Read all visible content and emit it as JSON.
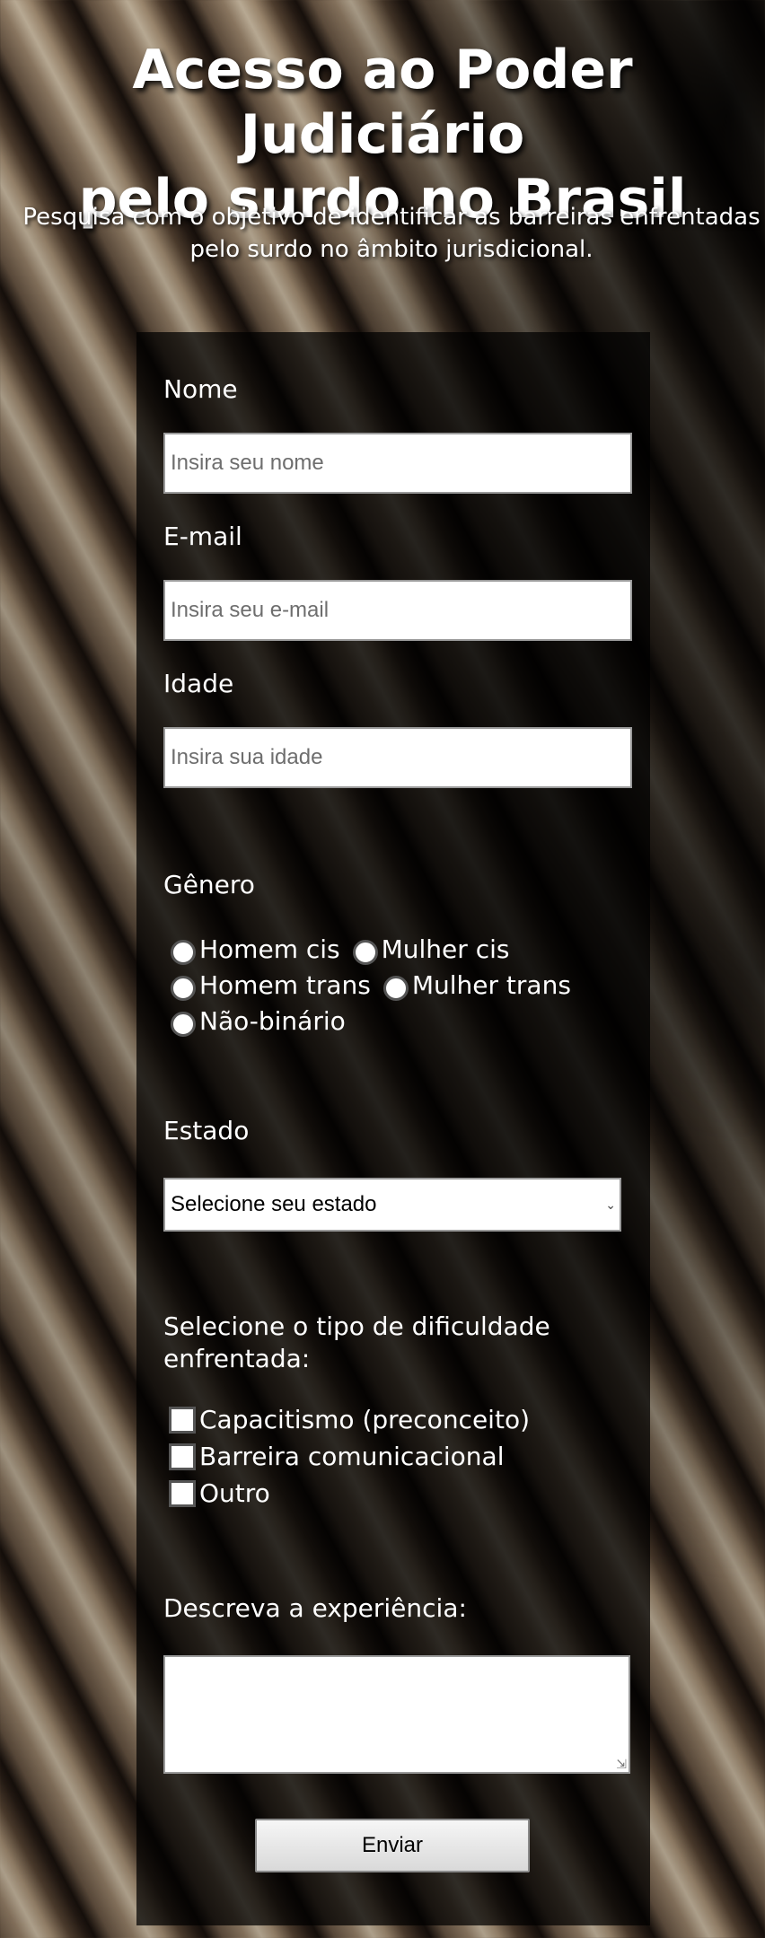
{
  "header": {
    "title_line1": "Acesso ao Poder Judiciário",
    "title_line2": "pelo surdo no Brasil",
    "subtitle_line1": "Pesquisa com o objetivo de identificar as barreiras enfrentadas",
    "subtitle_line2": "pelo surdo no âmbito jurisdicional."
  },
  "form": {
    "name": {
      "label": "Nome",
      "placeholder": "Insira seu nome",
      "value": ""
    },
    "email": {
      "label": "E-mail",
      "placeholder": "Insira seu e-mail",
      "value": ""
    },
    "age": {
      "label": "Idade",
      "placeholder": "Insira sua idade",
      "value": ""
    },
    "gender": {
      "label": "Gênero",
      "options": [
        "Homem cis",
        "Mulher cis",
        "Homem trans",
        "Mulher trans",
        "Não-binário"
      ],
      "selected": null
    },
    "state": {
      "label": "Estado",
      "selected": "Selecione seu estado"
    },
    "difficulty": {
      "label_line1": "Selecione o tipo de dificuldade",
      "label_line2": "enfrentada:",
      "options": [
        "Capacitismo (preconceito)",
        "Barreira comunicacional",
        "Outro"
      ],
      "checked": [
        false,
        false,
        false
      ]
    },
    "experience": {
      "label": "Descreva a experiência:",
      "value": ""
    },
    "submit_label": "Enviar"
  },
  "icons": {
    "select_chevron": "chevron-down-icon",
    "textarea_resize": "resize-grip-icon"
  },
  "colors": {
    "panel_overlay": "rgba(0,0,0,0.72)",
    "text": "#ffffff",
    "input_bg": "#ffffff"
  }
}
